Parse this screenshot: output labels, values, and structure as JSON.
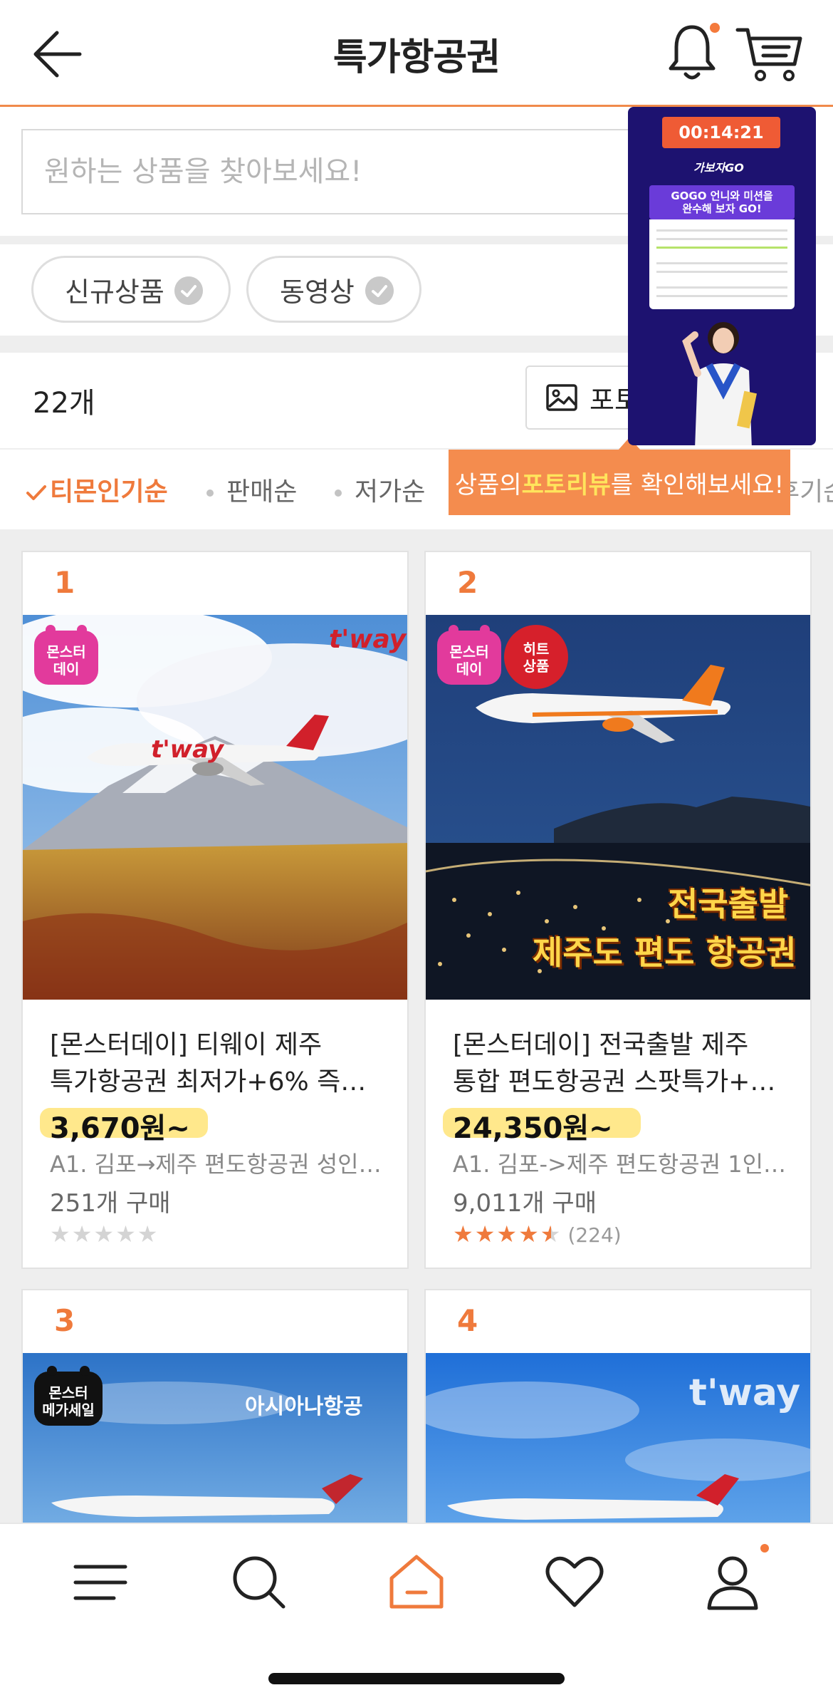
{
  "header": {
    "title": "특가항공권",
    "back_icon": "arrow-left-icon",
    "bell_icon": "bell-icon",
    "cart_icon": "cart-icon"
  },
  "search": {
    "placeholder": "원하는 상품을 찾아보세요!"
  },
  "filters": [
    {
      "label": "신규상품"
    },
    {
      "label": "동영상"
    }
  ],
  "results": {
    "count": "22개",
    "photo_review_label": "포토"
  },
  "sort": {
    "active": "티몬인기순",
    "options": [
      "판매순",
      "저가순"
    ],
    "clipped_right": "후기순"
  },
  "tooltip": {
    "before": "상품의 ",
    "highlight": "포토리뷰",
    "after": "를 확인해보세요!"
  },
  "live": {
    "timer": "00:14:21",
    "brand": "가보자GO",
    "headline_1": "GOGO 언니와 미션을",
    "headline_2": "완수해 보자 GO!"
  },
  "products": [
    {
      "rank": "1",
      "badge": "몬스터\n데이",
      "brand": "t'way",
      "title_1": "[몬스터데이] 티웨이 제주",
      "title_2": "특가항공권 최저가+6% 즉…",
      "price": "3,670원~",
      "option": "A1. 김포→제주 편도항공권 성인…",
      "sold": "251개 구매",
      "rating": 0,
      "review_count": ""
    },
    {
      "rank": "2",
      "badge": "몬스터\n데이",
      "badge2": "히트\n상품",
      "overlay_1": "전국출발",
      "overlay_2": "제주도 편도 항공권",
      "title_1": "[몬스터데이] 전국출발 제주",
      "title_2": "통합 편도항공권 스팟특가+…",
      "price": "24,350원~",
      "option": "A1. 김포->제주 편도항공권 1인…",
      "sold": "9,011개 구매",
      "rating": 4.5,
      "review_count": "(224)"
    },
    {
      "rank": "3",
      "badge": "몬스터\n메가세일",
      "brand": "아시아나항공"
    },
    {
      "rank": "4",
      "brand": "t'way"
    }
  ],
  "bottom_nav": {
    "items": [
      "menu-icon",
      "search-icon",
      "home-icon",
      "heart-icon",
      "user-icon"
    ]
  },
  "colors": {
    "accent": "#ef7a3c",
    "price_highlight": "#ffe680",
    "live_bg": "#1d1270"
  }
}
